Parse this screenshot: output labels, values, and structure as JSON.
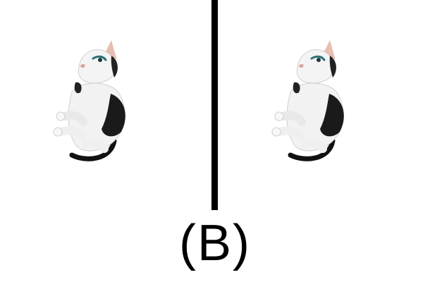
{
  "caption": "(B)",
  "images": [
    {
      "icon": "cat-photo-icon"
    },
    {
      "icon": "cat-photo-icon"
    }
  ],
  "colors": {
    "background": "#ffffff",
    "divider": "#000000",
    "caption": "#000000"
  }
}
